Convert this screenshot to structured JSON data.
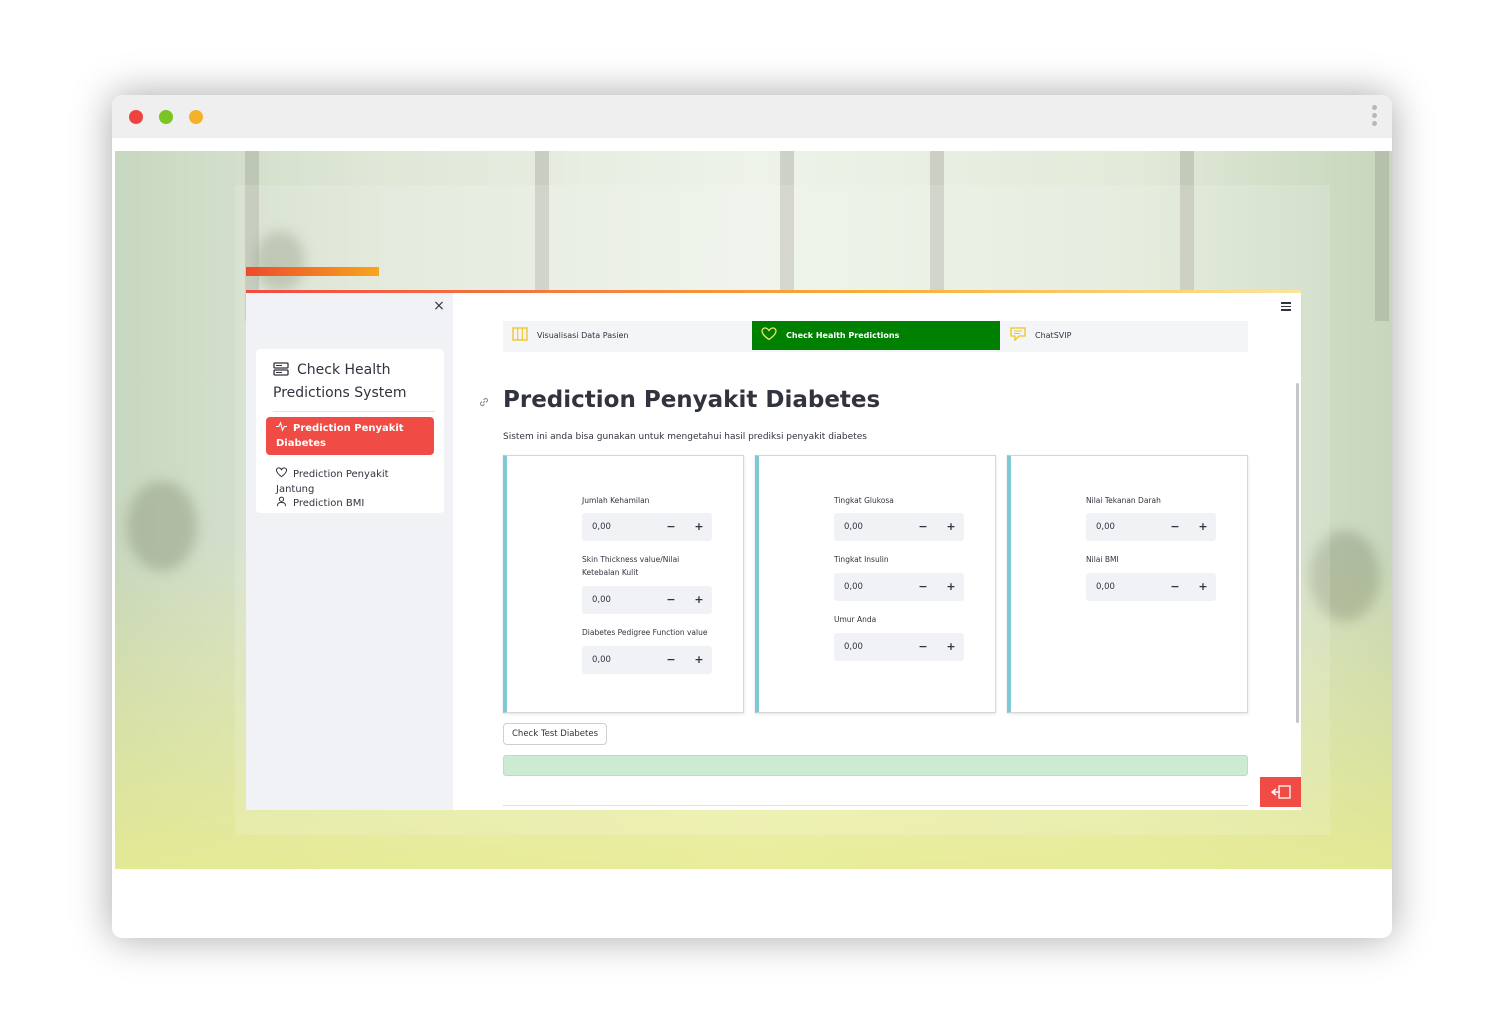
{
  "window": {
    "controls": [
      "close",
      "minimize",
      "maximize"
    ]
  },
  "sidebar": {
    "close_label": "×",
    "title": "Check Health Predictions System",
    "items": [
      {
        "label": "Prediction Penyakit Diabetes",
        "icon": "activity-icon",
        "active": true
      },
      {
        "label": "Prediction Penyakit Jantung",
        "icon": "heart-icon",
        "active": false
      },
      {
        "label": "Prediction BMI",
        "icon": "person-icon",
        "active": false
      }
    ]
  },
  "nav": {
    "tabs": [
      {
        "label": "Visualisasi Data Pasien",
        "icon": "columns-icon",
        "active": false
      },
      {
        "label": "Check Health Predictions",
        "icon": "heart-icon",
        "active": true
      },
      {
        "label": "ChatSVIP",
        "icon": "chat-icon",
        "active": false
      }
    ]
  },
  "page": {
    "title": "Prediction Penyakit Diabetes",
    "subtitle": "Sistem ini anda bisa gunakan untuk mengetahui hasil prediksi penyakit diabetes"
  },
  "form": {
    "col1": [
      {
        "label": "Jumlah Kehamilan",
        "value": "0,00"
      },
      {
        "label": "Skin Thickness value/Nilai Ketebalan Kulit",
        "value": "0,00"
      },
      {
        "label": "Diabetes Pedigree Function value",
        "value": "0,00"
      }
    ],
    "col2": [
      {
        "label": "Tingkat Glukosa",
        "value": "0,00"
      },
      {
        "label": "Tingkat Insulin",
        "value": "0,00"
      },
      {
        "label": "Umur Anda",
        "value": "0,00"
      }
    ],
    "col3": [
      {
        "label": "Nilai Tekanan Darah",
        "value": "0,00"
      },
      {
        "label": "Nilai BMI",
        "value": "0,00"
      }
    ],
    "minus_label": "−",
    "plus_label": "+",
    "submit_label": "Check Test Diabetes"
  },
  "colors": {
    "primary": "#f04b45",
    "nav_active": "#008000",
    "column_accent": "#7ec8d3",
    "result_bg": "#cdebd2"
  }
}
